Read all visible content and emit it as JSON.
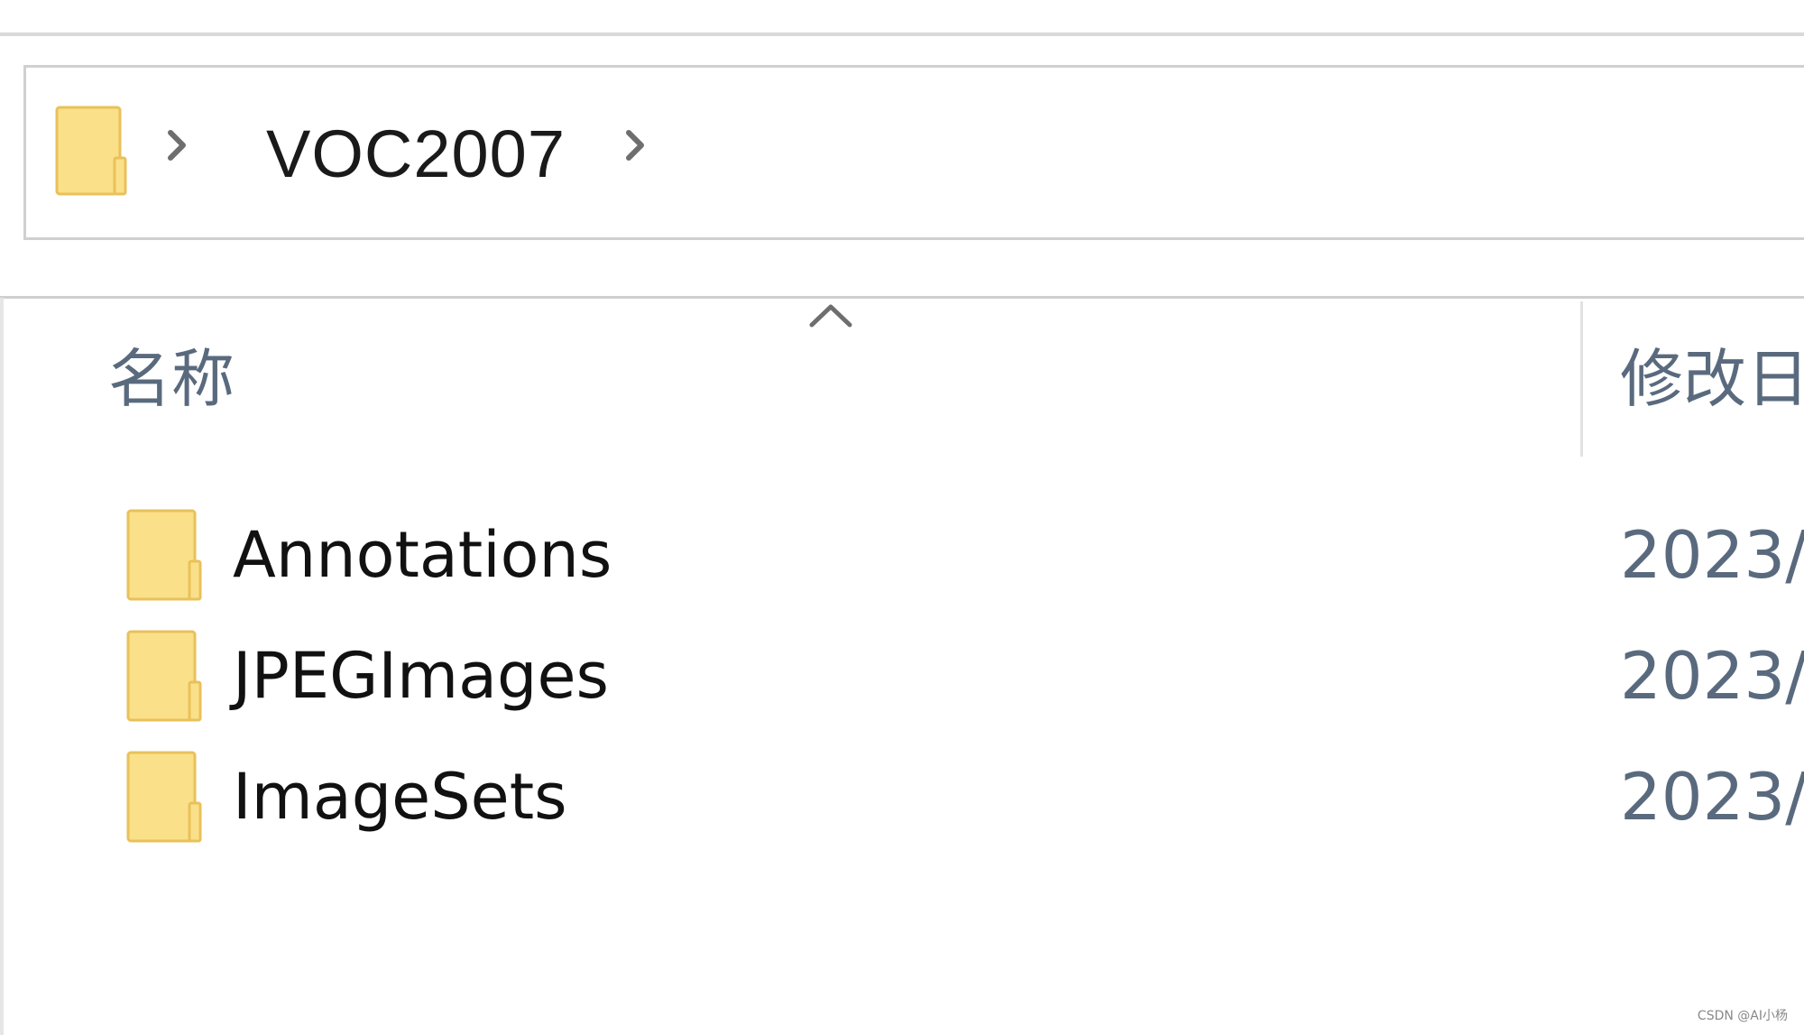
{
  "breadcrumb": {
    "items": [
      "VOC2007"
    ]
  },
  "columns": {
    "name_header": "名称",
    "date_header": "修改日"
  },
  "files": [
    {
      "name": "Annotations",
      "type": "folder",
      "date": "2023/"
    },
    {
      "name": "JPEGImages",
      "type": "folder",
      "date": "2023/"
    },
    {
      "name": "ImageSets",
      "type": "folder",
      "date": "2023/"
    }
  ],
  "icons": {
    "folder": "folder-icon",
    "chevron": "chevron-right-icon",
    "sort": "sort-up-icon"
  },
  "colors": {
    "folder_fill": "#fbe08a",
    "folder_edge": "#e8c15a",
    "header_text": "#5a6a7e",
    "item_text": "#111111"
  },
  "watermark": "CSDN @AI小杨"
}
